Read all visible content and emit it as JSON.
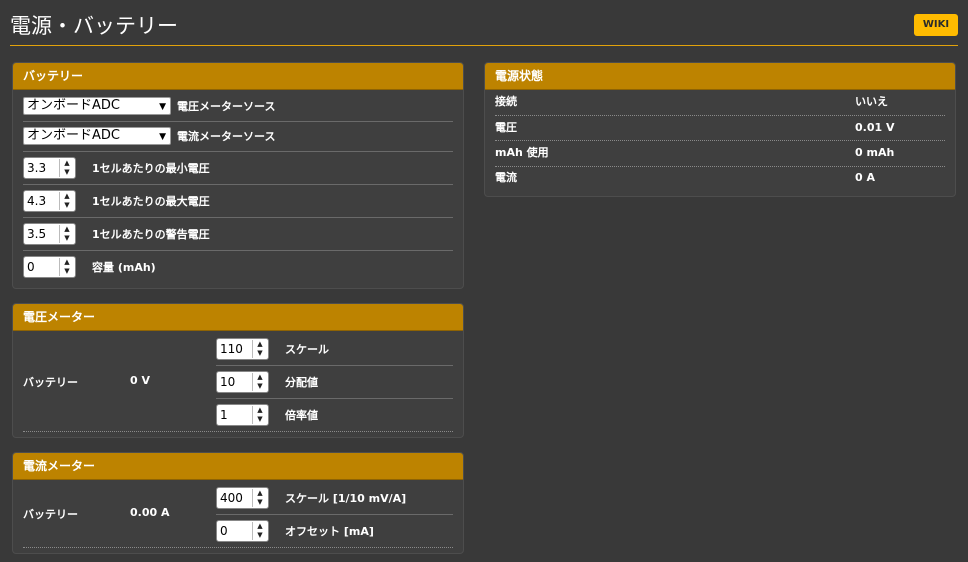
{
  "page": {
    "title": "電源・バッテリー",
    "wiki_label": "WIKI"
  },
  "battery": {
    "title": "バッテリー",
    "voltage_source": {
      "value": "オンボードADC",
      "label": "電圧メーターソース"
    },
    "current_source": {
      "value": "オンボードADC",
      "label": "電流メーターソース"
    },
    "min_cell": {
      "value": "3.3",
      "label": "1セルあたりの最小電圧"
    },
    "max_cell": {
      "value": "4.3",
      "label": "1セルあたりの最大電圧"
    },
    "warn_cell": {
      "value": "3.5",
      "label": "1セルあたりの警告電圧"
    },
    "capacity": {
      "value": "0",
      "label": "容量 (mAh)"
    }
  },
  "voltage_meter": {
    "title": "電圧メーター",
    "name": "バッテリー",
    "reading": "0 V",
    "scale": {
      "value": "110",
      "label": "スケール"
    },
    "divider": {
      "value": "10",
      "label": "分配値"
    },
    "multiplier": {
      "value": "1",
      "label": "倍率値"
    }
  },
  "current_meter": {
    "title": "電流メーター",
    "name": "バッテリー",
    "reading": "0.00 A",
    "scale": {
      "value": "400",
      "label": "スケール [1/10 mV/A]"
    },
    "offset": {
      "value": "0",
      "label": "オフセット [mA]"
    }
  },
  "power_status": {
    "title": "電源状態",
    "rows": [
      {
        "label": "接続",
        "value": "いいえ"
      },
      {
        "label": "電圧",
        "value": "0.01 V"
      },
      {
        "label": "mAh 使用",
        "value": "0 mAh"
      },
      {
        "label": "電流",
        "value": "0 A"
      }
    ]
  },
  "icons": {
    "dropdown": "triangle-down-icon",
    "spinner": "up-down-arrows-icon"
  }
}
